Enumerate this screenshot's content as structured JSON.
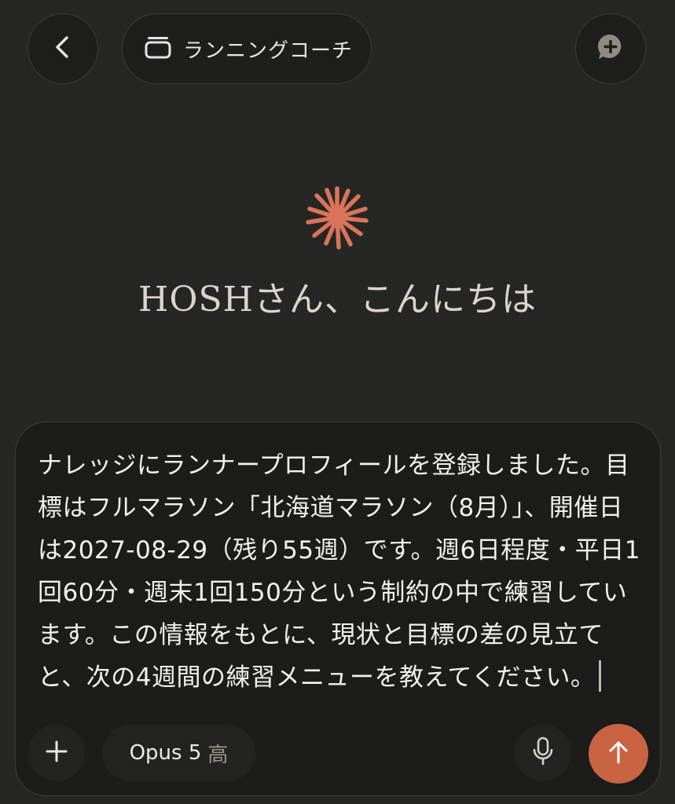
{
  "header": {
    "back_icon": "chevron-left-icon",
    "project": {
      "icon": "project-folder-icon",
      "label": "ランニングコーチ"
    },
    "new_chat_icon": "chat-plus-icon"
  },
  "main": {
    "logo_icon": "claude-sparkle-icon",
    "greeting": "HOSHさん、こんにちは"
  },
  "composer": {
    "text": "ナレッジにランナープロフィールを登録しました。目標はフルマラソン「北海道マラソン（8月）」、開催日は2027-08-29（残り55週）です。週6日程度・平日1回60分・週末1回150分という制約の中で練習しています。この情報をもとに、現状と目標の差の見立てと、次の4週間の練習メニューを教えてください。",
    "model_name": "Opus 5",
    "model_level": "高",
    "icons": {
      "add": "plus-icon",
      "mic": "microphone-icon",
      "send": "arrow-up-icon"
    }
  },
  "colors": {
    "background": "#262625",
    "accent": "#c96442",
    "composer_bg": "#1c1c1b"
  }
}
